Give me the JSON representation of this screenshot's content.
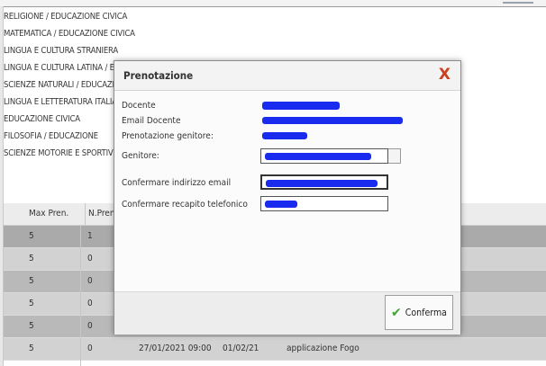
{
  "background": {
    "subjects": [
      "RELIGIONE / EDUCAZIONE CIVICA",
      "MATEMATICA / EDUCAZIONE CIVICA",
      "LINGUA E CULTURA STRANIERA",
      "LINGUA E CULTURA LATINA / EDUCAZIONE",
      "SCIENZE NATURALI / EDUCAZIONE",
      "LINGUA E LETTERATURA ITALIANA",
      "EDUCAZIONE CIVICA",
      "FILOSOFIA / EDUCAZIONE",
      "SCIENZE MOTORIE E SPORTIVE"
    ],
    "table": {
      "headers": [
        "Max Pren.",
        "N.Pren."
      ],
      "rows": [
        {
          "max": "5",
          "n": "1",
          "date": "",
          "time": "",
          "place": ""
        },
        {
          "max": "5",
          "n": "0",
          "date": "",
          "time": "",
          "place": ""
        },
        {
          "max": "5",
          "n": "0",
          "date": "",
          "time": "",
          "place": ""
        },
        {
          "max": "5",
          "n": "0",
          "date": "",
          "time": "",
          "place": ""
        },
        {
          "max": "5",
          "n": "0",
          "date": "",
          "time": "",
          "place": ""
        },
        {
          "max": "5",
          "n": "0",
          "date": "27/01/2021 09:00",
          "time": "01/02/21",
          "place": "applicazione Fogo"
        }
      ]
    }
  },
  "dialog": {
    "title": "Prenotazione",
    "close_icon": "close-icon",
    "labels": {
      "docente": "Docente",
      "email_docente": "Email Docente",
      "prenotazione_genitore": "Prenotazione genitore:",
      "genitore": "Genitore:",
      "confirm_email": "Confermare indirizzo email",
      "confirm_phone": "Confermare recapito telefonico"
    },
    "confirm_button": {
      "label": "Conferma",
      "icon": "check-icon"
    },
    "colors": {
      "close": "#c9421f",
      "check": "#3ea336",
      "redaction": "#1a2bf0"
    }
  }
}
